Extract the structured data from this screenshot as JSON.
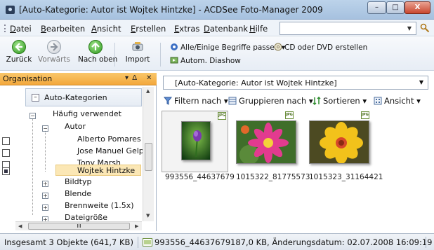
{
  "window": {
    "title": "[Auto-Kategorie: Autor ist Wojtek Hintzke] - ACDSee Foto-Manager 2009",
    "min": "–",
    "max": "□",
    "close": "X"
  },
  "menu": {
    "items": [
      "Datei",
      "Bearbeiten",
      "Ansicht",
      "Erstellen",
      "Extras",
      "Datenbank",
      "Hilfe"
    ],
    "search_value": "",
    "search_dropdown": "▼"
  },
  "toolbar": {
    "back": "Zurück",
    "forward": "Vorwärts",
    "up": "Nach oben",
    "import": "Import",
    "match_terms": "Alle/Einige Begriffe passen",
    "burn_disc": "CD oder DVD erstellen",
    "slideshow": "Autom. Diashow"
  },
  "organisation": {
    "title": "Organisation",
    "pin": "▾  Δ",
    "close": "✕",
    "category_root": "Auto-Kategorien",
    "tree": [
      {
        "label": "Häufig verwendet",
        "expander": "−"
      },
      {
        "label": "Autor",
        "expander": "−"
      },
      {
        "label": "Alberto Pomares G."
      },
      {
        "label": "Jose Manuel Gelpi"
      },
      {
        "label": "Tony Marsh"
      },
      {
        "label": "Wojtek Hintzke",
        "selected": true
      },
      {
        "label": "Bildtyp",
        "expander": "+"
      },
      {
        "label": "Blende",
        "expander": "+"
      },
      {
        "label": "Brennweite (1.5x)",
        "expander": "+"
      },
      {
        "label": "Dateigröße",
        "expander": "+"
      }
    ],
    "hscroll_thumb": "III"
  },
  "content": {
    "path": "[Auto-Kategorie: Autor ist Wojtek Hintzke]",
    "filter": "Filtern nach",
    "group": "Gruppieren nach",
    "sort": "Sortieren",
    "view": "Ansicht",
    "badge": "JPG",
    "files": [
      {
        "name": "993556_44637679",
        "selected": true
      },
      {
        "name": "1015322_81775573",
        "selected": false
      },
      {
        "name": "1015323_31164421",
        "selected": false
      }
    ]
  },
  "status": {
    "total": "Insgesamt 3 Objekte  (641,7 KB)",
    "current_file": "993556_44637679",
    "details": "187,0 KB, Änderungsdatum: 02.07.2008 16:09:19"
  },
  "colors": {
    "panel_header": "#f3a83c",
    "selection": "#fbe7b5",
    "title_bar": "#a6c1df"
  }
}
